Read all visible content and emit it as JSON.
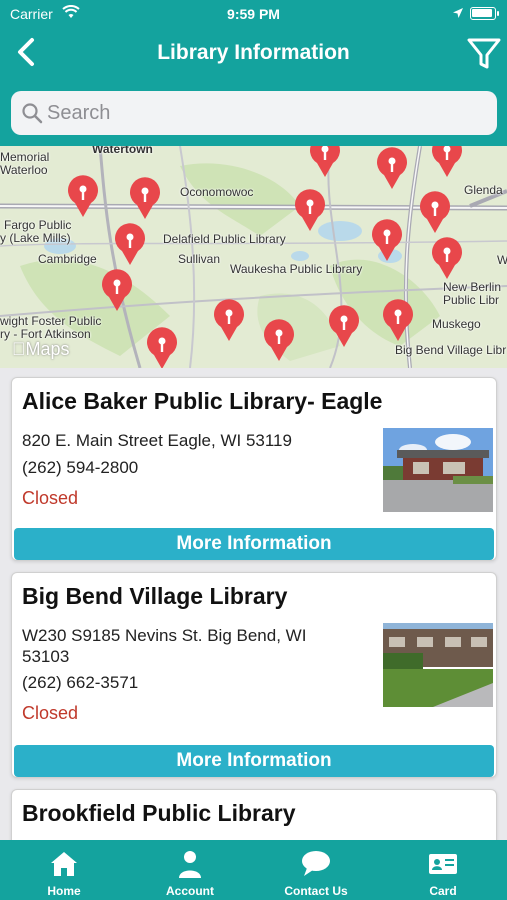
{
  "status_bar": {
    "carrier": "Carrier",
    "time": "9:59 PM"
  },
  "header": {
    "title": "Library Information",
    "back_icon": "chevron-left-icon",
    "filter_icon": "filter-funnel-icon"
  },
  "search": {
    "placeholder": "Search"
  },
  "map": {
    "labels": [
      "Watertown",
      "Memorial",
      "Waterloo",
      "Oconomowoc",
      "Glenda",
      "Fargo Public",
      "y (Lake Mills)",
      "Delafield Public Library",
      "Cambridge",
      "Sullivan",
      "Waukesha Public Library",
      "W",
      "New Berlin",
      "Public Libr",
      "wight Foster Public",
      "ry - Fort Atkinson",
      "Muskego",
      "Big Bend Village Libr"
    ],
    "attribution": "Maps",
    "pin_icon": "map-pin-icon"
  },
  "libraries": [
    {
      "name": "Alice Baker Public Library- Eagle",
      "address": "820 E. Main Street  Eagle, WI 53119",
      "phone": "(262) 594-2800",
      "status": "Closed",
      "button": "More Information"
    },
    {
      "name": "Big Bend Village Library",
      "address": "W230 S9185 Nevins St.  Big Bend, WI 53103",
      "phone": "(262) 662-3571",
      "status": "Closed",
      "button": "More Information"
    },
    {
      "name": "Brookfield Public Library"
    }
  ],
  "tabs": [
    {
      "label": "Home",
      "icon": "home-icon"
    },
    {
      "label": "Account",
      "icon": "person-icon"
    },
    {
      "label": "Contact Us",
      "icon": "chat-bubble-icon"
    },
    {
      "label": "Card",
      "icon": "id-card-icon"
    }
  ],
  "colors": {
    "primary": "#14a39e",
    "button": "#2bb0c9",
    "closed": "#c0392b",
    "pin": "#e8474b"
  }
}
